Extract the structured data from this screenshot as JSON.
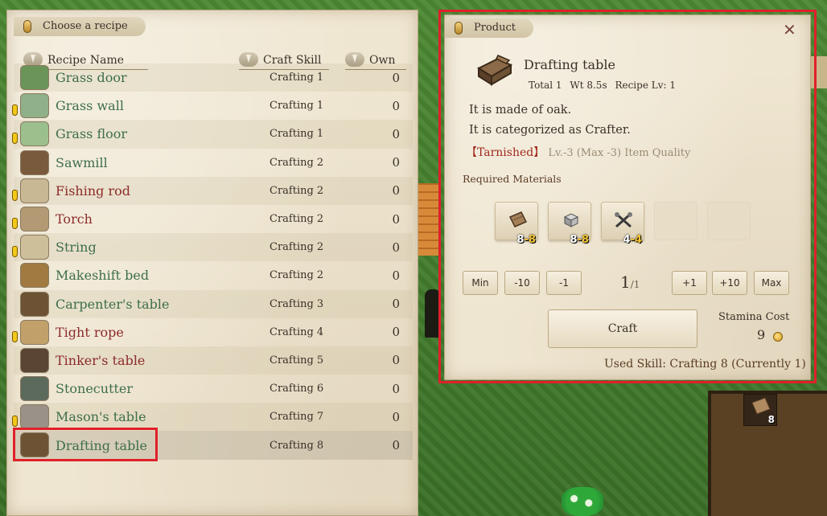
{
  "recipe_panel": {
    "title": "Choose a recipe",
    "columns": {
      "name": "Recipe Name",
      "skill": "Craft Skill",
      "own": "Own"
    },
    "recipes": [
      {
        "name": "Grass door",
        "skill": "Crafting 1",
        "own": "0",
        "color": "green",
        "alert": false,
        "icon": "grass-door-icon"
      },
      {
        "name": "Grass wall",
        "skill": "Crafting 1",
        "own": "0",
        "color": "green",
        "alert": true,
        "icon": "grass-wall-icon"
      },
      {
        "name": "Grass floor",
        "skill": "Crafting 1",
        "own": "0",
        "color": "green",
        "alert": true,
        "icon": "grass-floor-icon"
      },
      {
        "name": "Sawmill",
        "skill": "Crafting 2",
        "own": "0",
        "color": "green",
        "alert": false,
        "icon": "sawmill-icon"
      },
      {
        "name": "Fishing rod",
        "skill": "Crafting 2",
        "own": "0",
        "color": "red",
        "alert": true,
        "icon": "fishing-rod-icon"
      },
      {
        "name": "Torch",
        "skill": "Crafting 2",
        "own": "0",
        "color": "red",
        "alert": true,
        "icon": "torch-icon"
      },
      {
        "name": "String",
        "skill": "Crafting 2",
        "own": "0",
        "color": "green",
        "alert": true,
        "icon": "string-icon"
      },
      {
        "name": "Makeshift bed",
        "skill": "Crafting 2",
        "own": "0",
        "color": "green",
        "alert": false,
        "icon": "makeshift-bed-icon"
      },
      {
        "name": "Carpenter's table",
        "skill": "Crafting 3",
        "own": "0",
        "color": "green",
        "alert": false,
        "icon": "carpenters-table-icon"
      },
      {
        "name": "Tight rope",
        "skill": "Crafting 4",
        "own": "0",
        "color": "red",
        "alert": true,
        "icon": "tight-rope-icon"
      },
      {
        "name": "Tinker's table",
        "skill": "Crafting 5",
        "own": "0",
        "color": "red",
        "alert": false,
        "icon": "tinkers-table-icon"
      },
      {
        "name": "Stonecutter",
        "skill": "Crafting 6",
        "own": "0",
        "color": "green",
        "alert": false,
        "icon": "stonecutter-icon"
      },
      {
        "name": "Mason's table",
        "skill": "Crafting 7",
        "own": "0",
        "color": "green",
        "alert": true,
        "icon": "masons-table-icon"
      },
      {
        "name": "Drafting table",
        "skill": "Crafting 8",
        "own": "0",
        "color": "green",
        "alert": false,
        "icon": "drafting-table-icon",
        "selected": true
      }
    ]
  },
  "product_panel": {
    "title": "Product",
    "close_label": "✕",
    "name": "Drafting table",
    "total": "Total 1",
    "weight": "Wt 8.5s",
    "recipe_lv": "Recipe Lv: 1",
    "desc1": "It is made of oak.",
    "desc2": "It is categorized as Crafter.",
    "quality_tag": "【Tarnished】",
    "quality_level": "Lv.-3 (Max -3) Item Quality",
    "required_label": "Required Materials",
    "materials": [
      {
        "icon": "wood-plank-icon",
        "have": "8",
        "need": "-8"
      },
      {
        "icon": "stone-block-icon",
        "have": "8",
        "need": "-8"
      },
      {
        "icon": "tools-icon",
        "have": "4",
        "need": "-4"
      }
    ],
    "buttons": {
      "min": "Min",
      "minus10": "-10",
      "minus1": "-1",
      "plus1": "+1",
      "plus10": "+10",
      "max": "Max"
    },
    "quantity": "1",
    "quantity_max": "/1",
    "craft_label": "Craft",
    "stamina_label": "Stamina Cost",
    "stamina_value": "9",
    "used_skill": "Used Skill: Crafting 8 (Currently 1)"
  },
  "hud": {
    "slot_count": "8"
  },
  "colors": {
    "accent_red": "#e0202a",
    "green_text": "#3d6e4a",
    "red_text": "#8c2b2b"
  }
}
